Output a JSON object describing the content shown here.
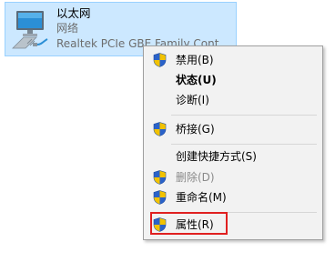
{
  "adapter": {
    "name": "以太网",
    "status": "网络",
    "device": "Realtek PCIe GBE Family Cont"
  },
  "context_menu": {
    "items": [
      {
        "label": "禁用(B)"
      },
      {
        "label": "状态(U)"
      },
      {
        "label": "诊断(I)"
      },
      {
        "label": "桥接(G)"
      },
      {
        "label": "创建快捷方式(S)"
      },
      {
        "label": "删除(D)"
      },
      {
        "label": "重命名(M)"
      },
      {
        "label": "属性(R)"
      }
    ]
  },
  "colors": {
    "selection_bg": "#cce8ff",
    "menu_bg": "#f2f2f2",
    "highlight_border": "#e02020",
    "shield_blue": "#2a62c9",
    "shield_yellow": "#f2c200"
  }
}
